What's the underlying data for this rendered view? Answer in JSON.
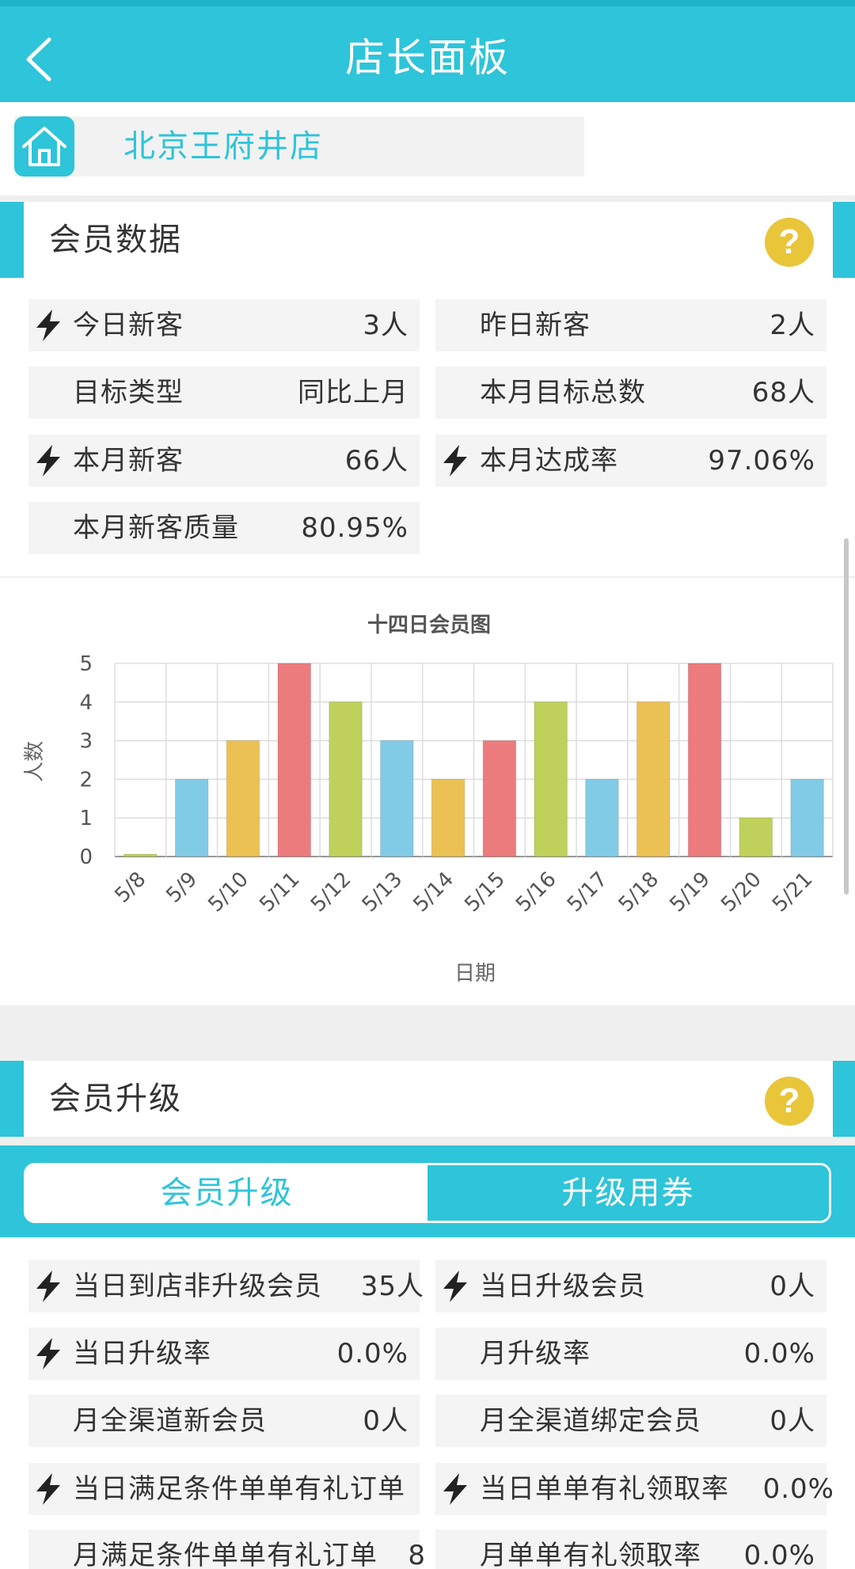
{
  "header": {
    "title": "店长面板"
  },
  "store": {
    "name": "北京王府井店"
  },
  "member_data": {
    "title": "会员数据",
    "help": "?",
    "rows": [
      {
        "label": "今日新客",
        "value": "3人",
        "bolt": true
      },
      {
        "label": "昨日新客",
        "value": "2人",
        "bolt": false
      },
      {
        "label": "目标类型",
        "value": "同比上月",
        "bolt": false
      },
      {
        "label": "本月目标总数",
        "value": "68人",
        "bolt": false
      },
      {
        "label": "本月新客",
        "value": "66人",
        "bolt": true
      },
      {
        "label": "本月达成率",
        "value": "97.06%",
        "bolt": true
      },
      {
        "label": "本月新客质量",
        "value": "80.95%",
        "bolt": false
      }
    ]
  },
  "chart_data": {
    "type": "bar",
    "title": "十四日会员图",
    "xlabel": "日期",
    "ylabel": "人数",
    "ylim": [
      0,
      5
    ],
    "yticks": [
      "0",
      "1",
      "2",
      "3",
      "4",
      "5"
    ],
    "grid": true,
    "categories": [
      "5/8",
      "5/9",
      "5/10",
      "5/11",
      "5/12",
      "5/13",
      "5/14",
      "5/15",
      "5/16",
      "5/17",
      "5/18",
      "5/19",
      "5/20",
      "5/21"
    ],
    "values": [
      0,
      2,
      3,
      5,
      4,
      3,
      2,
      3,
      4,
      2,
      4,
      5,
      1,
      2
    ],
    "colors": [
      "#bfd15a",
      "#82cbe6",
      "#ecc153",
      "#ec7b7e",
      "#bfd15a",
      "#82cbe6",
      "#ecc153",
      "#ec7b7e",
      "#bfd15a",
      "#82cbe6",
      "#ecc153",
      "#ec7b7e",
      "#bfd15a",
      "#82cbe6"
    ]
  },
  "member_upgrade": {
    "title": "会员升级",
    "help": "?",
    "tabs": [
      {
        "label": "会员升级",
        "active": true
      },
      {
        "label": "升级用券",
        "active": false
      }
    ],
    "rows": [
      {
        "label": "当日到店非升级会员",
        "value": "35人",
        "bolt": true
      },
      {
        "label": "当日升级会员",
        "value": "0人",
        "bolt": true
      },
      {
        "label": "当日升级率",
        "value": "0.0%",
        "bolt": true
      },
      {
        "label": "月升级率",
        "value": "0.0%",
        "bolt": false
      },
      {
        "label": "月全渠道新会员",
        "value": "0人",
        "bolt": false
      },
      {
        "label": "月全渠道绑定会员",
        "value": "0人",
        "bolt": false
      },
      {
        "label": "当日满足条件单单有礼订单",
        "value": "",
        "bolt": true
      },
      {
        "label": "当日单单有礼领取率",
        "value": "0.0%",
        "bolt": true
      },
      {
        "label": "月满足条件单单有礼订单",
        "value": "8",
        "bolt": false
      },
      {
        "label": "月单单有礼领取率",
        "value": "0.0%",
        "bolt": false
      }
    ]
  },
  "colors": {
    "accent": "#2ec4d9",
    "help": "#e9c53a",
    "cell_bg": "#f4f4f4"
  }
}
